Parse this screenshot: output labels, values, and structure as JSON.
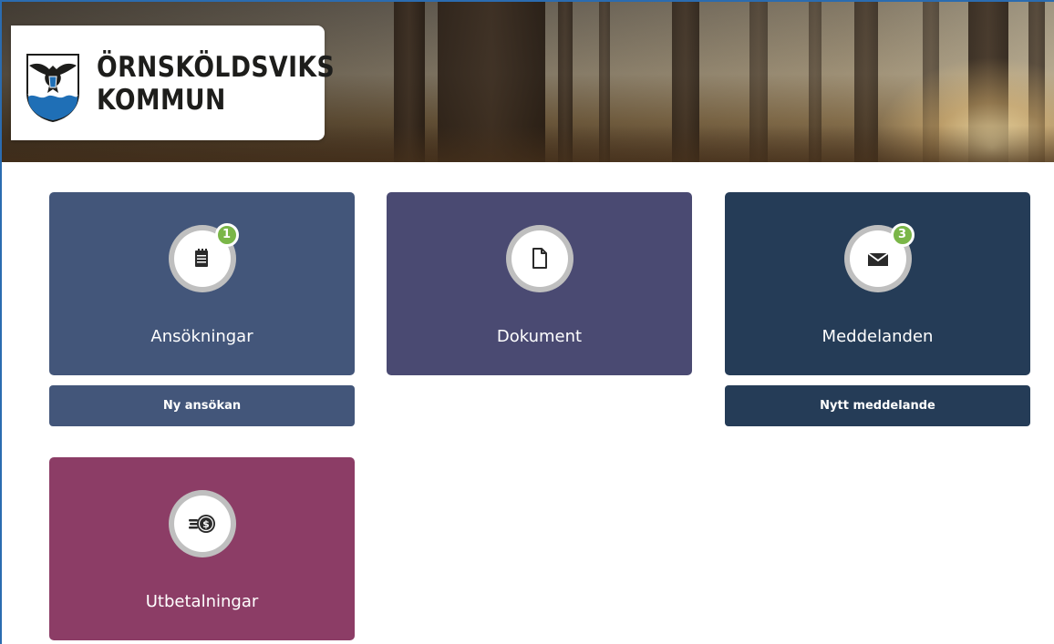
{
  "header": {
    "logo_line1": "ÖRNSKÖLDSVIKS",
    "logo_line2": "KOMMUN",
    "crest_icon": "eagle-crest-icon"
  },
  "tiles": [
    {
      "label": "Ansökningar",
      "icon": "notepad-icon",
      "badge": "1",
      "color": "#43567a",
      "action_label": "Ny ansökan"
    },
    {
      "label": "Dokument",
      "icon": "document-icon",
      "badge": "",
      "color": "#4a4a72"
    },
    {
      "label": "Meddelanden",
      "icon": "envelope-icon",
      "badge": "3",
      "color": "#253c57",
      "action_label": "Nytt meddelande"
    },
    {
      "label": "Utbetalningar",
      "icon": "coins-dollar-icon",
      "badge": "",
      "color": "#8c3d66"
    }
  ],
  "colors": {
    "badge_green": "#7ab648",
    "frame_blue": "#2b6cb0"
  }
}
